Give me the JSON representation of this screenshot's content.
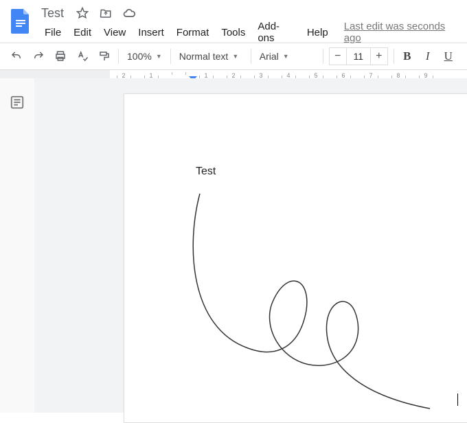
{
  "header": {
    "title": "Test",
    "last_edit": "Last edit was seconds ago"
  },
  "menus": [
    "File",
    "Edit",
    "View",
    "Insert",
    "Format",
    "Tools",
    "Add-ons",
    "Help"
  ],
  "toolbar": {
    "zoom": "100%",
    "style": "Normal text",
    "font": "Arial",
    "font_size": "11",
    "bold": "B",
    "italic": "I",
    "underline": "U"
  },
  "ruler": [
    "2",
    "1",
    "",
    "1",
    "2",
    "3",
    "4",
    "5",
    "6",
    "7",
    "8",
    "9"
  ],
  "document": {
    "body_text": "Test"
  }
}
